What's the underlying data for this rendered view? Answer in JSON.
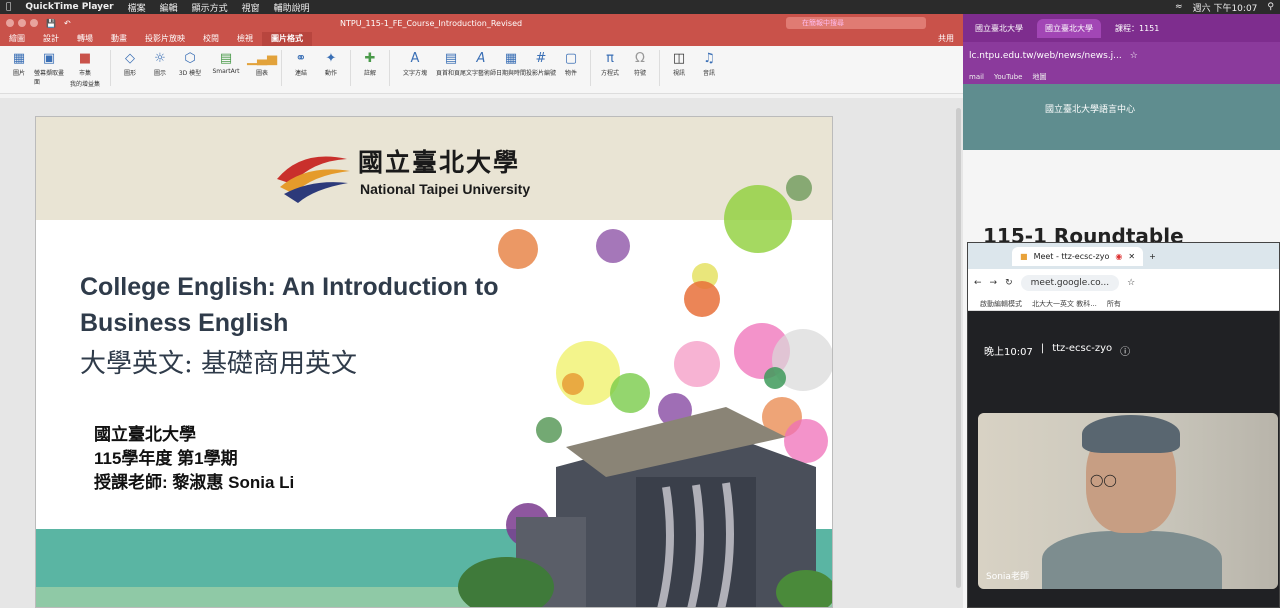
{
  "menubar": {
    "app": "QuickTime Player",
    "items": [
      "檔案",
      "編輯",
      "顯示方式",
      "視窗",
      "輔助說明"
    ],
    "clock": "週六 下午10:07"
  },
  "ppt": {
    "doc_title": "NTPU_115-1_FE_Course_Introduction_Revised",
    "search_placeholder": "在簡報中搜尋",
    "tabs": [
      "繪圖",
      "設計",
      "轉場",
      "動畫",
      "投影片放映",
      "校閱",
      "檢視",
      "圖片格式"
    ],
    "share": "共用",
    "ribbon": [
      {
        "label": "圖片",
        "icon": "picture-icon"
      },
      {
        "label": "螢幕擷取畫面",
        "icon": "screenshot-icon"
      },
      {
        "label": "市集",
        "icon": "store-icon"
      },
      {
        "label": "我的增益集",
        "icon": "addin-icon"
      },
      {
        "label": "圖形",
        "icon": "shapes-icon"
      },
      {
        "label": "圖示",
        "icon": "icons-icon"
      },
      {
        "label": "3D 模型",
        "icon": "3d-icon"
      },
      {
        "label": "SmartArt",
        "icon": "smartart-icon"
      },
      {
        "label": "圖表",
        "icon": "chart-icon"
      },
      {
        "label": "連結",
        "icon": "link-icon"
      },
      {
        "label": "動作",
        "icon": "action-icon"
      },
      {
        "label": "註解",
        "icon": "comment-icon"
      },
      {
        "label": "文字方塊",
        "icon": "textbox-icon"
      },
      {
        "label": "頁首和頁尾",
        "icon": "header-icon"
      },
      {
        "label": "文字藝術師",
        "icon": "wordart-icon"
      },
      {
        "label": "日期與時間",
        "icon": "date-icon"
      },
      {
        "label": "投影片編號",
        "icon": "slidenum-icon"
      },
      {
        "label": "物件",
        "icon": "object-icon"
      },
      {
        "label": "方程式",
        "icon": "equation-icon"
      },
      {
        "label": "符號",
        "icon": "symbol-icon"
      },
      {
        "label": "視訊",
        "icon": "video-icon"
      },
      {
        "label": "音訊",
        "icon": "audio-icon"
      }
    ]
  },
  "slide": {
    "logo_zh": "國立臺北大學",
    "logo_en": "National Taipei University",
    "title_en": "College English: An Introduction to Business English",
    "title_zh": "大學英文: 基礎商用英文",
    "info": [
      "國立臺北大學",
      "115學年度 第1學期",
      "授課老師: 黎淑惠 Sonia Li"
    ]
  },
  "chrome": {
    "tabs": [
      "國立臺北大學",
      "國立臺北大學",
      "課程：1151"
    ],
    "url": "lc.ntpu.edu.tw/web/news/news.j...",
    "bookmarks": [
      "mail",
      "YouTube",
      "地圖"
    ],
    "hero": "國立臺北大學語言中心",
    "heading": "115-1 Roundtable"
  },
  "meet": {
    "tab": "Meet - ttz-ecsc-zyo",
    "url": "meet.google.co...",
    "bookmarks": [
      "啟動編輯模式",
      "北大大一英文 教科...",
      "所有"
    ],
    "time": "晚上10:07",
    "code": "ttz-ecsc-zyo",
    "speaker": "Sonia老師"
  }
}
